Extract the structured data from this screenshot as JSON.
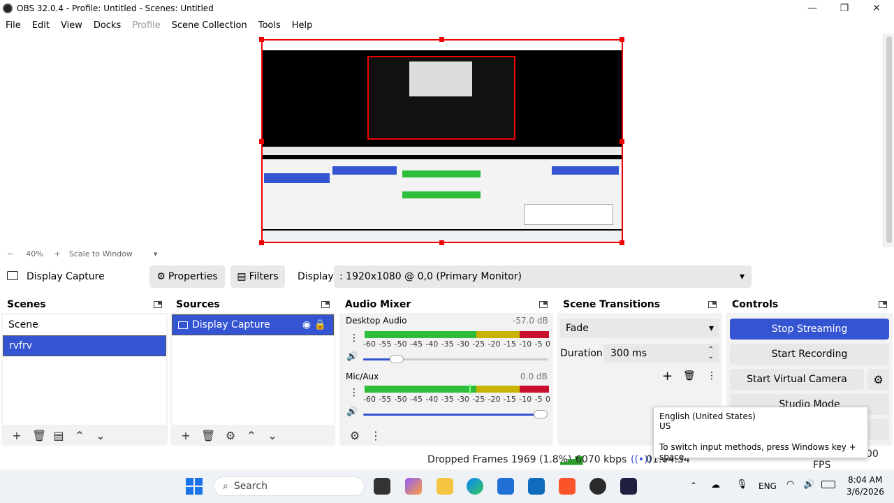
{
  "window": {
    "title": "OBS 32.0.4 - Profile: Untitled - Scenes: Untitled"
  },
  "menu": [
    "File",
    "Edit",
    "View",
    "Docks",
    "Profile",
    "Scene Collection",
    "Tools",
    "Help"
  ],
  "zoom": {
    "minus": "−",
    "value": "40%",
    "plus": "+",
    "mode": "Scale to Window"
  },
  "source_bar": {
    "selected_source": "Display Capture",
    "properties_label": "Properties",
    "filters_label": "Filters",
    "display_label": "Display",
    "display_value": ": 1920x1080 @ 0,0 (Primary Monitor)"
  },
  "scenes": {
    "title": "Scenes",
    "items": [
      "Scene",
      "rvfrv"
    ],
    "selected_index": 1
  },
  "sources": {
    "title": "Sources",
    "items": [
      "Display Capture"
    ]
  },
  "mixer": {
    "title": "Audio Mixer",
    "channels": [
      {
        "name": "Desktop Audio",
        "db": "-57.0 dB",
        "level": 0.45,
        "volume": 0.18
      },
      {
        "name": "Mic/Aux",
        "db": "0.0 dB",
        "level": 0.58,
        "volume": 1.0
      }
    ],
    "scale": [
      "-60",
      "-55",
      "-50",
      "-45",
      "-40",
      "-35",
      "-30",
      "-25",
      "-20",
      "-15",
      "-10",
      "-5",
      "0"
    ]
  },
  "transitions": {
    "title": "Scene Transitions",
    "selected": "Fade",
    "duration_label": "Duration",
    "duration_value": "300 ms"
  },
  "controls": {
    "title": "Controls",
    "stop_streaming": "Stop Streaming",
    "start_recording": "Start Recording",
    "start_virtual_camera": "Start Virtual Camera",
    "studio_mode": "Studio Mode"
  },
  "status": {
    "dropped_frames": "Dropped Frames 1969 (1.8%)",
    "bitrate": "6070 kbps",
    "time": "01:04:54",
    "fps": "30.00 / 30.00 FPS"
  },
  "tooltip": {
    "line1": "English (United States)",
    "line2": "US",
    "line3": "To switch input methods, press Windows key + space."
  },
  "taskbar": {
    "search_placeholder": "Search",
    "lang": "ENG",
    "clock_time": "8:04 AM",
    "clock_date": "3/6/2026"
  },
  "colors": {
    "accent": "#3454d1",
    "selection_red": "#e00000",
    "meter_green": "#2dbd3a",
    "meter_yellow": "#c8b400",
    "meter_red": "#c8102e"
  }
}
